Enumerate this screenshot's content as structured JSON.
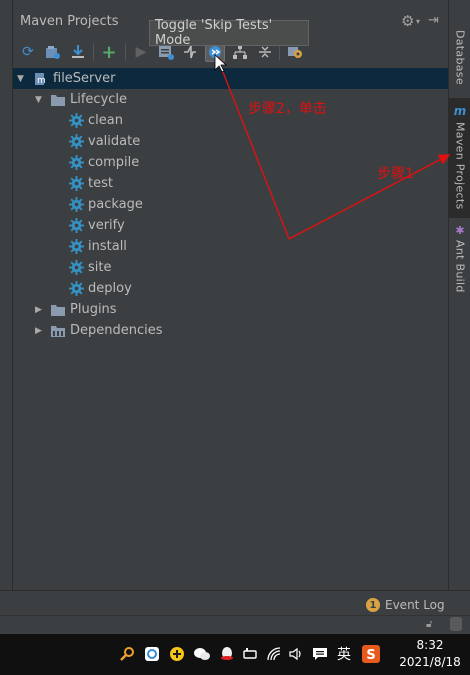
{
  "panel": {
    "title": "Maven Projects"
  },
  "toolbar": {
    "tooltip": "Toggle 'Skip Tests' Mode",
    "buttons": [
      {
        "icon": "reimport-icon"
      },
      {
        "icon": "generate-sources-icon"
      },
      {
        "icon": "download-icon"
      },
      {
        "icon": "add-icon"
      },
      {
        "icon": "run-icon"
      },
      {
        "icon": "execute-goal-icon"
      },
      {
        "icon": "toggle-offline-icon"
      },
      {
        "icon": "skip-tests-icon"
      },
      {
        "icon": "show-dependencies-icon"
      },
      {
        "icon": "collapse-all-icon"
      },
      {
        "icon": "settings-icon"
      }
    ]
  },
  "tree": {
    "root": "fileServer",
    "lifecycle_label": "Lifecycle",
    "lifecycle": [
      "clean",
      "validate",
      "compile",
      "test",
      "package",
      "verify",
      "install",
      "site",
      "deploy"
    ],
    "plugins_label": "Plugins",
    "dependencies_label": "Dependencies"
  },
  "right_tabs": [
    "Database",
    "Maven Projects",
    "Ant Build"
  ],
  "annotations": {
    "step2": "步骤2，单击",
    "step1": "步骤1"
  },
  "bottom": {
    "event_log_count": "1",
    "event_log_label": "Event Log"
  },
  "taskbar": {
    "ime": "英",
    "time": "8:32",
    "date": "2021/8/18"
  },
  "colors": {
    "panel_bg": "#3c3f41",
    "selection": "#0d293e",
    "annotation": "#e01010",
    "gear_blue": "#3592c4"
  }
}
